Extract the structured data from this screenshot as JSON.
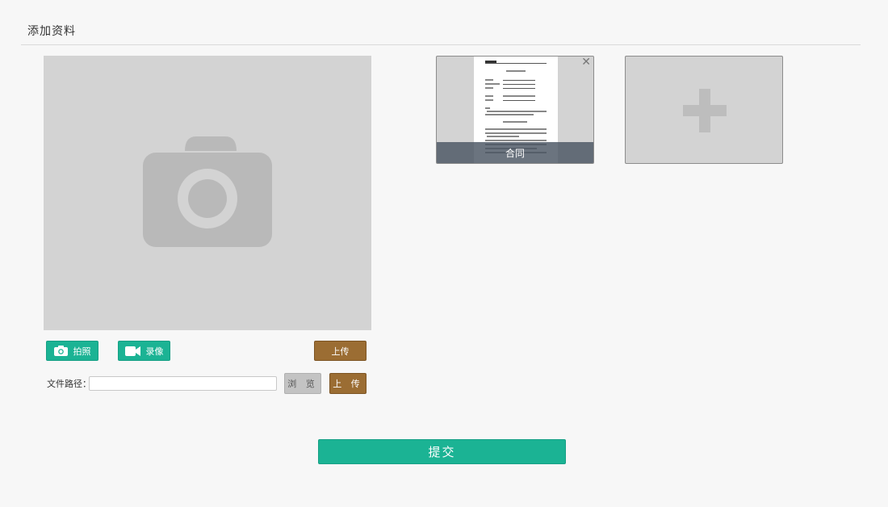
{
  "page": {
    "title": "添加资料"
  },
  "capture": {
    "camera_icon": "camera-icon",
    "photo_label": "拍照",
    "record_label": "录像",
    "upload_label": "上传"
  },
  "file": {
    "path_label": "文件路径：",
    "path_value": "",
    "browse_label": "浏 览",
    "upload_label": "上 传"
  },
  "thumbnails": [
    {
      "caption": "合同",
      "close_icon": "close-icon"
    },
    {
      "add_icon": "plus-icon"
    }
  ],
  "submit_label": "提交",
  "colors": {
    "accent_green": "#1bb394",
    "brown": "#9b6d33",
    "placeholder_gray": "#d3d3d3"
  }
}
